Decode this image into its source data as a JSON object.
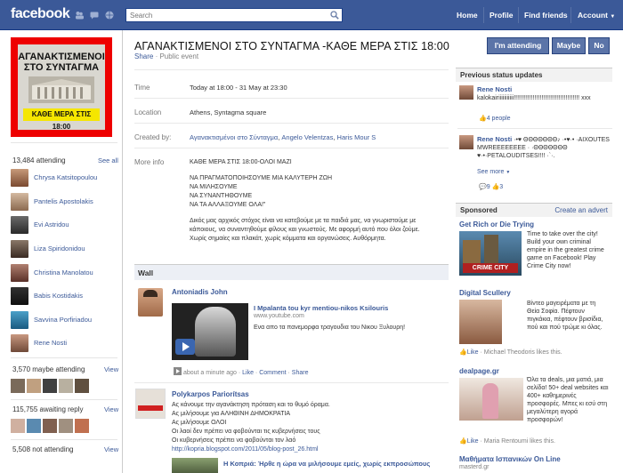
{
  "topbar": {
    "logo": "facebook",
    "search_placeholder": "Search",
    "nav": [
      "Home",
      "Profile",
      "Find friends",
      "Account"
    ]
  },
  "event": {
    "poster_lines": [
      "ΑΓΑΝΑΚΤΙΣΜΕΝΟΙ",
      "ΣΤΟ ΣΥΝΤΑΓΜΑ"
    ],
    "poster_caption": "ΚΑΘΕ ΜΕΡΑ ΣΤΙΣ  18:00",
    "title": "ΑΓΑΝΑΚΤΙΣΜΕΝΟΙ ΣΤΟ ΣΥΝΤΑΓΜΑ -ΚΑΘΕ ΜΕΡΑ ΣΤΙΣ 18:00",
    "share": "Share",
    "privacy": "Public event",
    "buttons": {
      "attending": "I'm attending",
      "maybe": "Maybe",
      "no": "No"
    },
    "time_label": "Time",
    "time_value": "Today at 18:00 - 31 May at 23:30",
    "location_label": "Location",
    "location_value": "Athens, Syntagma square",
    "created_label": "Created by:",
    "created_by": [
      "Αγανακτισμένοι στο Σύνταγμα",
      "Angelo Velentzas",
      "Haris Mour S"
    ],
    "moreinfo_label": "More info",
    "moreinfo_lines": [
      "ΚΑΘΕ ΜΕΡΑ ΣΤΙΣ 18:00-ΟΛΟΙ ΜΑΖΙ",
      "",
      "ΝΑ ΠΡΑΓΜΑΤΟΠΟΙΗΣΟΥΜΕ ΜΙΑ ΚΑΛΥΤΕΡΗ ΖΩΗ",
      "ΝΑ ΜΙΛΗΣΟΥΜΕ",
      "ΝΑ ΣΥΝΑΝΤΗΘΟΥΜΕ",
      "ΝΑ ΤΑ ΑΛΛΑΞΟΥΜΕ ΟΛΑ!\"",
      "",
      "Δικός μας αρχικός στόχος είναι να κατεβούμε με τα παιδιά μας, να γνωριστούμε με",
      "κάποιους, να συναντηθούμε φίλους και γνωστούς. Με αφορμή αυτό που όλοι ζούμε.",
      "Χωρίς σημαίες και πλακάτ, χωρίς κόμματα και οργανώσεις. Αυθόρμητα."
    ]
  },
  "attendees": {
    "attending_header": "13,484 attending",
    "see_all": "See all",
    "people": [
      "Chrysa Katsitopoulou",
      "Pantelis Apostolakis",
      "Evi Astridou",
      "Liza Spiridonidou",
      "Christina Manolatou",
      "Babis Kostidakis",
      "Savvina Porfiriadou",
      "Rene Nosti"
    ],
    "maybe_header": "3,570 maybe attending",
    "awaiting_header": "115,755 awaiting reply",
    "not_header": "5,508 not attending",
    "view": "View"
  },
  "wall": {
    "header": "Wall",
    "post1": {
      "author": "Antoniadis John",
      "link_title": "I Mpalanta tou kyr mentiou-nikos Ksilouris",
      "link_url": "www.youtube.com",
      "link_desc": "Ενα απο τα πανεμορφα τραγουδια του Νικου Ξυλουρη!",
      "time": "about a minute ago",
      "actions": [
        "Like",
        "Comment",
        "Share"
      ]
    },
    "post2": {
      "author": "Polykarpos Pariorítsas",
      "lines": [
        "Ας κάνουμε την αγανάκτηση πρόταση και το θυμό όραμα.",
        "Ας μιλήσουμε για ΑΛΗΘΙΝΗ ΔΗΜΟΚΡΑΤΙΑ",
        "Ας μιλήσουμε ΟΛΟΙ",
        "Οι λαοί δεν πρέπει να φοβούνται τις κυβερνήσεις τους",
        "Οι κυβερνήσεις πρέπει να φοβούνται τον λαό"
      ],
      "link": "http://kopria.blogspot.com/2011/05/blog-post_26.html",
      "next_title": "Η Κοπριά: Ήρθε η ώρα να μιλήσουμε εμείς, χωρίς εκπροσώπους"
    }
  },
  "status_updates": {
    "header": "Previous status updates",
    "items": [
      {
        "name": "Rene Nosti",
        "text": "kalokairiiiiiiiiiii!!!!!!!!!!!!!!!!!!!!!!!!!!!!!!!!!!!!!! xxx",
        "likes": "4 people"
      },
      {
        "name": "Rene Nosti",
        "text": "·•♥ ΘΘΘΘΘΘΘ♪ ·•♥·• ·AIXOUTES MWREEEEEEEE · ·ΘΘΘΘΘΘΘ ♥·•·PETALOUDITSES!!!! ·`·.",
        "see_more": "See more",
        "comments": "9",
        "likes": "3"
      }
    ]
  },
  "sponsored": {
    "header": "Sponsored",
    "create": "Create an advert",
    "ads": [
      {
        "title": "Get Rich or Die Trying",
        "text": "Time to take over the city! Build your own criminal empire in the greatest crime game on Facebook! Play Crime City now!",
        "image_caption": "CRIME CITY"
      },
      {
        "title": "Digital Scullery",
        "text": "Βίντεο μαγειρέματα με τη Θεία Σοφία. Πέφτουν πιγκάκια, πέφτουν βρισίδια, πού και πού τρώμε κι όλας.",
        "like": "Like",
        "liker": "Michael Theodoris likes this."
      },
      {
        "title": "dealpage.gr",
        "text": "Όλα τα deals, μια ματιά, μια σελίδα! 50+ deal websites και 400+ καθημερινές προσφορές. Μπες κι εσύ στη μεγαλύτερη αγορά προσφορών!",
        "like": "Like",
        "liker": "Maria Rentoumi likes this."
      },
      {
        "title": "Μαθήματα Ισπανικών On Line",
        "text": "masterd.gr"
      }
    ]
  }
}
